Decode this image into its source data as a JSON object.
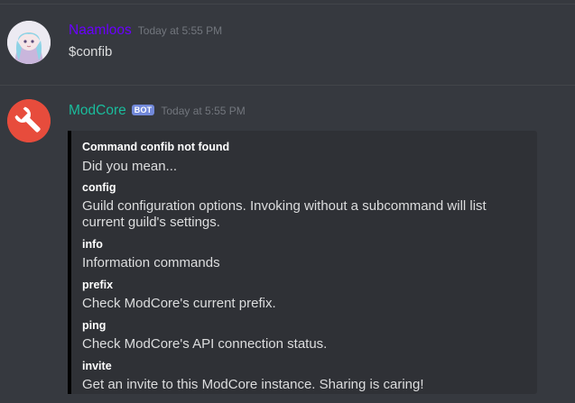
{
  "messages": [
    {
      "username": "Naamloos",
      "username_color": "#6a00ff",
      "timestamp": "Today at 5:55 PM",
      "text": "$confib"
    },
    {
      "username": "ModCore",
      "username_color": "#1abc9c",
      "bot_tag": "BOT",
      "timestamp": "Today at 5:55 PM",
      "embed": {
        "title": "Command confib not found",
        "description": "Did you mean...",
        "fields": [
          {
            "name": "config",
            "value": "Guild configuration options. Invoking without a subcommand will list current guild's settings."
          },
          {
            "name": "info",
            "value": "Information commands"
          },
          {
            "name": "prefix",
            "value": "Check ModCore's current prefix."
          },
          {
            "name": "ping",
            "value": "Check ModCore's API connection status."
          },
          {
            "name": "invite",
            "value": "Get an invite to this ModCore instance. Sharing is caring!"
          }
        ]
      }
    }
  ],
  "colors": {
    "background": "#36393f",
    "embed_background": "#2f3136",
    "embed_border": "#000000",
    "bot_tag": "#7289da"
  },
  "icons": {
    "avatar_user": "anime-character-avatar",
    "avatar_bot": "wrench-icon"
  }
}
